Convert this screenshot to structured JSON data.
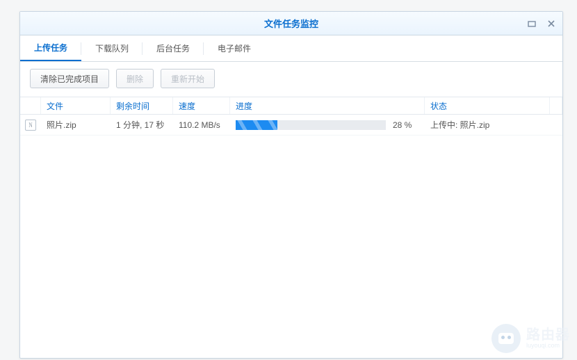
{
  "window": {
    "title": "文件任务监控"
  },
  "tabs": {
    "items": [
      {
        "label": "上传任务",
        "active": true
      },
      {
        "label": "下载队列",
        "active": false
      },
      {
        "label": "后台任务",
        "active": false
      },
      {
        "label": "电子邮件",
        "active": false
      }
    ]
  },
  "toolbar": {
    "clear_completed": "清除已完成项目",
    "delete": "删除",
    "restart": "重新开始"
  },
  "columns": {
    "file": "文件",
    "remaining": "剩余时间",
    "speed": "速度",
    "progress": "进度",
    "status": "状态"
  },
  "rows": [
    {
      "icon": "document-icon",
      "file": "照片.zip",
      "remaining": "1 分钟, 17 秒",
      "speed": "110.2 MB/s",
      "progress_pct": 28,
      "progress_text": "28 %",
      "status": "上传中: 照片.zip"
    }
  ],
  "watermark": {
    "brand": "路由器",
    "sub": "luyouqi.com"
  }
}
